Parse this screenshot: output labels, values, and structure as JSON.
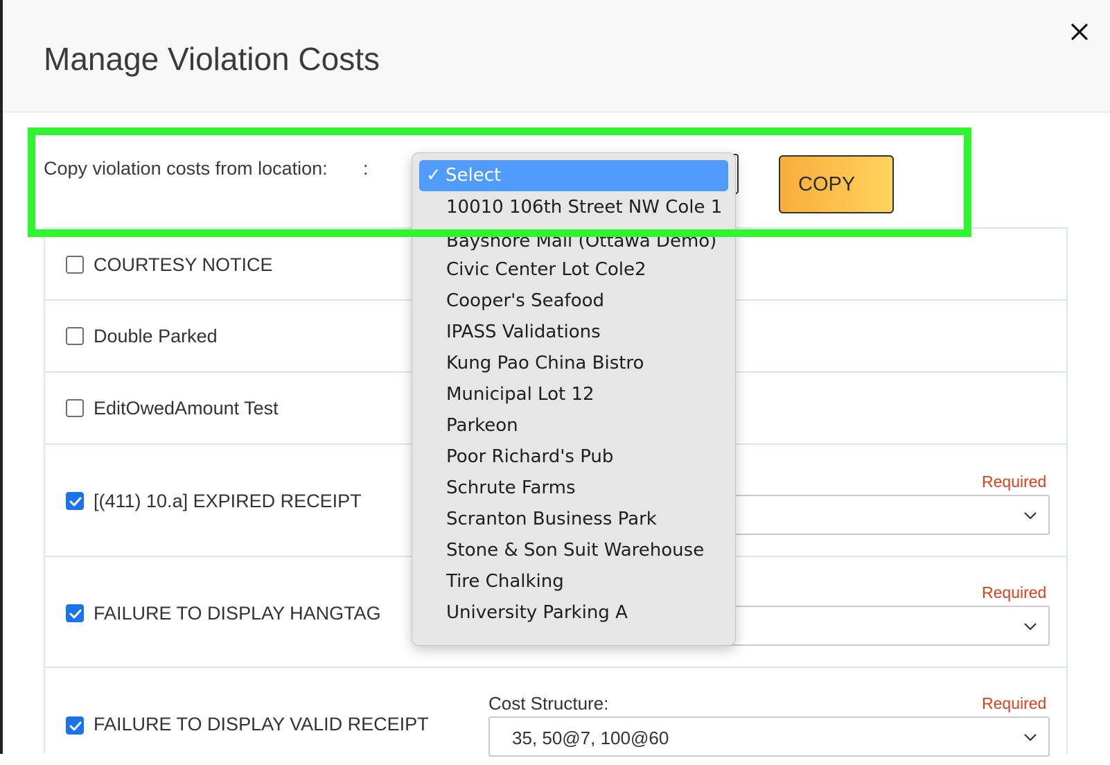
{
  "modal": {
    "title": "Manage Violation Costs"
  },
  "copy_section": {
    "label": "Copy violation costs from location:",
    "colon": ":",
    "copy_button": "COPY"
  },
  "dropdown": {
    "selected_label": "Select",
    "check_glyph": "✓",
    "options": [
      "10010 106th Street NW Cole 1",
      "Bayshore Mall (Ottawa Demo)",
      "Civic Center Lot Cole2",
      "Cooper's Seafood",
      "IPASS Validations",
      "Kung Pao China Bistro",
      "Municipal Lot 12",
      "Parkeon",
      "Poor Richard's Pub",
      "Schrute Farms",
      "Scranton Business Park",
      "Stone & Son Suit Warehouse",
      "Tire Chalking",
      "University Parking A"
    ]
  },
  "violations": [
    {
      "label": "COURTESY NOTICE",
      "checked": false
    },
    {
      "label": "Double Parked",
      "checked": false
    },
    {
      "label": "EditOwedAmount Test",
      "checked": false
    },
    {
      "label": "[(411) 10.a] EXPIRED RECEIPT",
      "checked": true,
      "required": "Required"
    },
    {
      "label": "FAILURE TO DISPLAY HANGTAG",
      "checked": true,
      "required": "Required"
    },
    {
      "label": "FAILURE TO DISPLAY VALID RECEIPT",
      "checked": true,
      "required": "Required",
      "cost_structure_label": "Cost Structure:",
      "cost_structure_value": "35, 50@7, 100@60"
    }
  ],
  "colors": {
    "highlight": "#2ef52e",
    "checkbox_checked": "#1a73e8",
    "required_text": "#d9411e",
    "copy_button_gradient": [
      "#f9ad3b",
      "#ffd35c"
    ],
    "dropdown_selected": "#4f9cfa"
  }
}
